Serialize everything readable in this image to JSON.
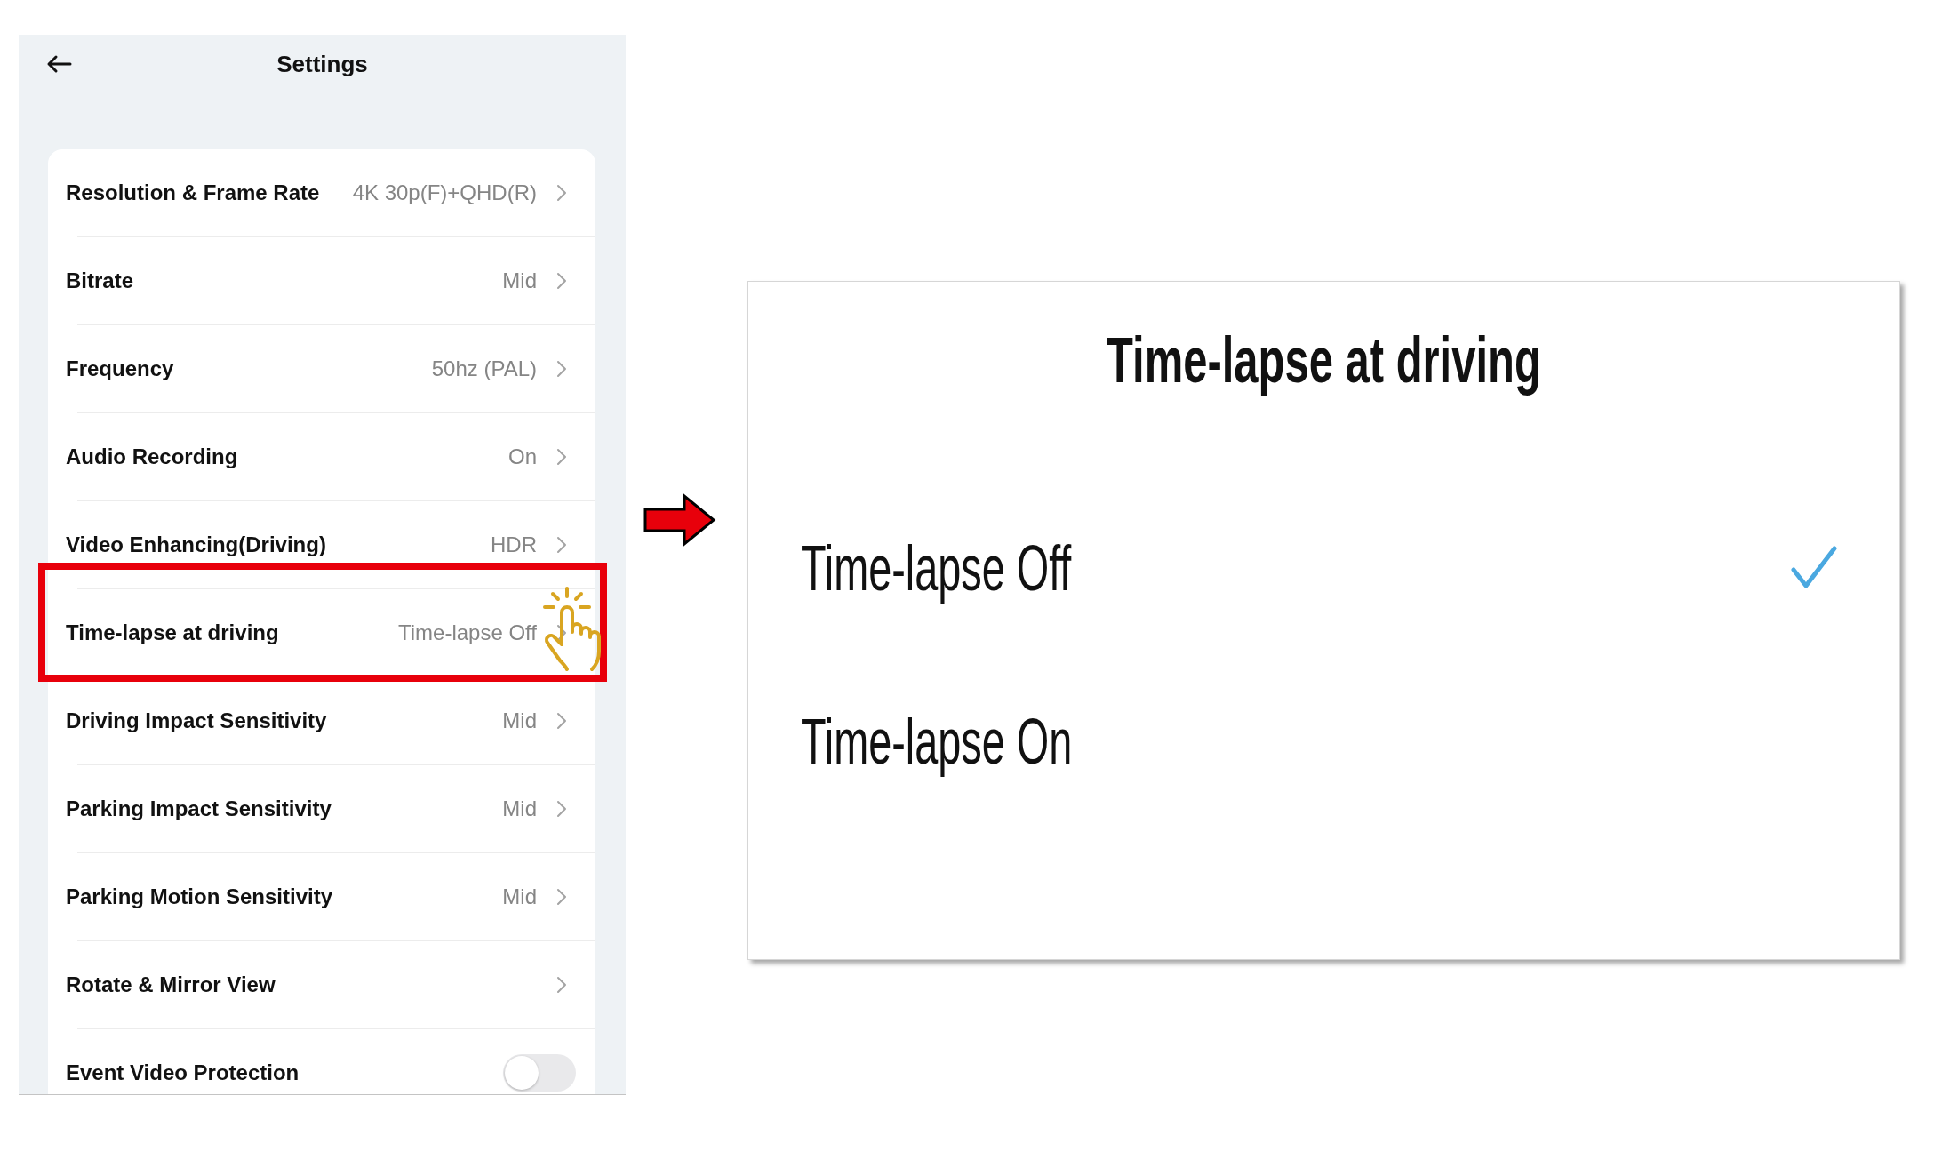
{
  "settings": {
    "title": "Settings",
    "items": [
      {
        "kind": "nav",
        "label": "Resolution & Frame Rate",
        "value": "4K 30p(F)+QHD(R)",
        "highlighted": false
      },
      {
        "kind": "nav",
        "label": "Bitrate",
        "value": "Mid",
        "highlighted": false
      },
      {
        "kind": "nav",
        "label": "Frequency",
        "value": "50hz (PAL)",
        "highlighted": false
      },
      {
        "kind": "nav",
        "label": "Audio Recording",
        "value": "On",
        "highlighted": false
      },
      {
        "kind": "nav",
        "label": "Video Enhancing(Driving)",
        "value": "HDR",
        "highlighted": false
      },
      {
        "kind": "nav",
        "label": "Time-lapse at driving",
        "value": "Time-lapse Off",
        "highlighted": true
      },
      {
        "kind": "nav",
        "label": "Driving Impact Sensitivity",
        "value": "Mid",
        "highlighted": false
      },
      {
        "kind": "nav",
        "label": "Parking Impact Sensitivity",
        "value": "Mid",
        "highlighted": false
      },
      {
        "kind": "nav",
        "label": "Parking Motion Sensitivity",
        "value": "Mid",
        "highlighted": false
      },
      {
        "kind": "nav",
        "label": "Rotate & Mirror View",
        "highlighted": false
      },
      {
        "kind": "toggle",
        "label": "Event Video Protection",
        "on": false,
        "highlighted": false
      }
    ]
  },
  "dialog": {
    "title": "Time-lapse at driving",
    "options": [
      {
        "label": "Time-lapse Off",
        "selected": true
      },
      {
        "label": "Time-lapse On",
        "selected": false
      }
    ]
  }
}
